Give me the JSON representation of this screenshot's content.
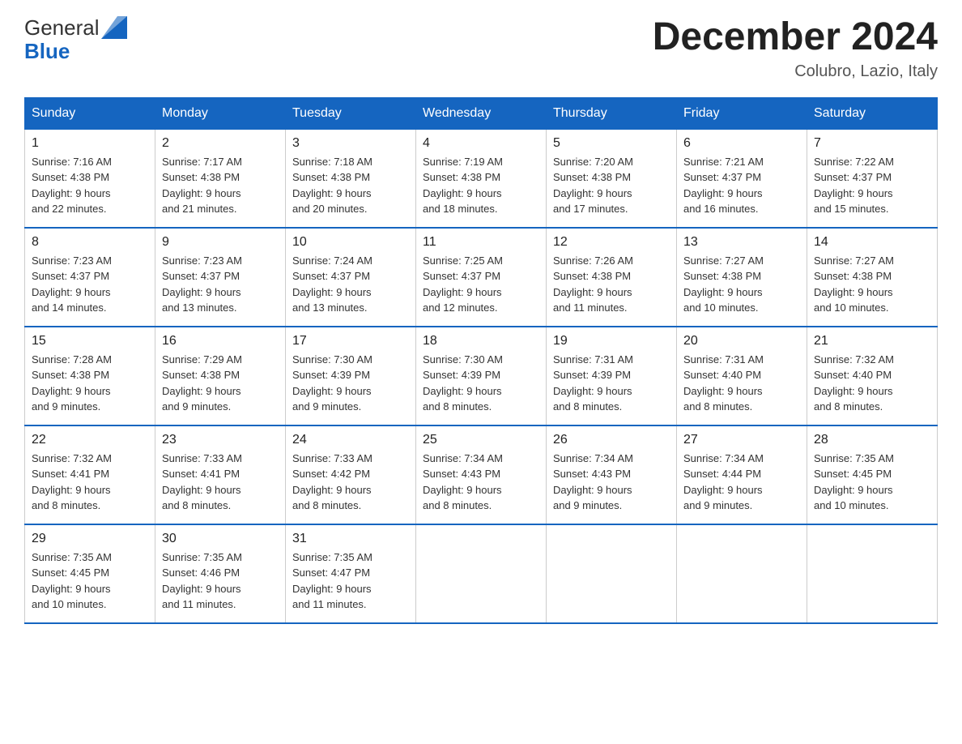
{
  "logo": {
    "general": "General",
    "blue": "Blue"
  },
  "title": "December 2024",
  "subtitle": "Colubro, Lazio, Italy",
  "weekdays": [
    "Sunday",
    "Monday",
    "Tuesday",
    "Wednesday",
    "Thursday",
    "Friday",
    "Saturday"
  ],
  "weeks": [
    [
      {
        "day": "1",
        "sunrise": "7:16 AM",
        "sunset": "4:38 PM",
        "daylight": "9 hours and 22 minutes."
      },
      {
        "day": "2",
        "sunrise": "7:17 AM",
        "sunset": "4:38 PM",
        "daylight": "9 hours and 21 minutes."
      },
      {
        "day": "3",
        "sunrise": "7:18 AM",
        "sunset": "4:38 PM",
        "daylight": "9 hours and 20 minutes."
      },
      {
        "day": "4",
        "sunrise": "7:19 AM",
        "sunset": "4:38 PM",
        "daylight": "9 hours and 18 minutes."
      },
      {
        "day": "5",
        "sunrise": "7:20 AM",
        "sunset": "4:38 PM",
        "daylight": "9 hours and 17 minutes."
      },
      {
        "day": "6",
        "sunrise": "7:21 AM",
        "sunset": "4:37 PM",
        "daylight": "9 hours and 16 minutes."
      },
      {
        "day": "7",
        "sunrise": "7:22 AM",
        "sunset": "4:37 PM",
        "daylight": "9 hours and 15 minutes."
      }
    ],
    [
      {
        "day": "8",
        "sunrise": "7:23 AM",
        "sunset": "4:37 PM",
        "daylight": "9 hours and 14 minutes."
      },
      {
        "day": "9",
        "sunrise": "7:23 AM",
        "sunset": "4:37 PM",
        "daylight": "9 hours and 13 minutes."
      },
      {
        "day": "10",
        "sunrise": "7:24 AM",
        "sunset": "4:37 PM",
        "daylight": "9 hours and 13 minutes."
      },
      {
        "day": "11",
        "sunrise": "7:25 AM",
        "sunset": "4:37 PM",
        "daylight": "9 hours and 12 minutes."
      },
      {
        "day": "12",
        "sunrise": "7:26 AM",
        "sunset": "4:38 PM",
        "daylight": "9 hours and 11 minutes."
      },
      {
        "day": "13",
        "sunrise": "7:27 AM",
        "sunset": "4:38 PM",
        "daylight": "9 hours and 10 minutes."
      },
      {
        "day": "14",
        "sunrise": "7:27 AM",
        "sunset": "4:38 PM",
        "daylight": "9 hours and 10 minutes."
      }
    ],
    [
      {
        "day": "15",
        "sunrise": "7:28 AM",
        "sunset": "4:38 PM",
        "daylight": "9 hours and 9 minutes."
      },
      {
        "day": "16",
        "sunrise": "7:29 AM",
        "sunset": "4:38 PM",
        "daylight": "9 hours and 9 minutes."
      },
      {
        "day": "17",
        "sunrise": "7:30 AM",
        "sunset": "4:39 PM",
        "daylight": "9 hours and 9 minutes."
      },
      {
        "day": "18",
        "sunrise": "7:30 AM",
        "sunset": "4:39 PM",
        "daylight": "9 hours and 8 minutes."
      },
      {
        "day": "19",
        "sunrise": "7:31 AM",
        "sunset": "4:39 PM",
        "daylight": "9 hours and 8 minutes."
      },
      {
        "day": "20",
        "sunrise": "7:31 AM",
        "sunset": "4:40 PM",
        "daylight": "9 hours and 8 minutes."
      },
      {
        "day": "21",
        "sunrise": "7:32 AM",
        "sunset": "4:40 PM",
        "daylight": "9 hours and 8 minutes."
      }
    ],
    [
      {
        "day": "22",
        "sunrise": "7:32 AM",
        "sunset": "4:41 PM",
        "daylight": "9 hours and 8 minutes."
      },
      {
        "day": "23",
        "sunrise": "7:33 AM",
        "sunset": "4:41 PM",
        "daylight": "9 hours and 8 minutes."
      },
      {
        "day": "24",
        "sunrise": "7:33 AM",
        "sunset": "4:42 PM",
        "daylight": "9 hours and 8 minutes."
      },
      {
        "day": "25",
        "sunrise": "7:34 AM",
        "sunset": "4:43 PM",
        "daylight": "9 hours and 8 minutes."
      },
      {
        "day": "26",
        "sunrise": "7:34 AM",
        "sunset": "4:43 PM",
        "daylight": "9 hours and 9 minutes."
      },
      {
        "day": "27",
        "sunrise": "7:34 AM",
        "sunset": "4:44 PM",
        "daylight": "9 hours and 9 minutes."
      },
      {
        "day": "28",
        "sunrise": "7:35 AM",
        "sunset": "4:45 PM",
        "daylight": "9 hours and 10 minutes."
      }
    ],
    [
      {
        "day": "29",
        "sunrise": "7:35 AM",
        "sunset": "4:45 PM",
        "daylight": "9 hours and 10 minutes."
      },
      {
        "day": "30",
        "sunrise": "7:35 AM",
        "sunset": "4:46 PM",
        "daylight": "9 hours and 11 minutes."
      },
      {
        "day": "31",
        "sunrise": "7:35 AM",
        "sunset": "4:47 PM",
        "daylight": "9 hours and 11 minutes."
      },
      null,
      null,
      null,
      null
    ]
  ],
  "labels": {
    "sunrise": "Sunrise:",
    "sunset": "Sunset:",
    "daylight": "Daylight:"
  }
}
